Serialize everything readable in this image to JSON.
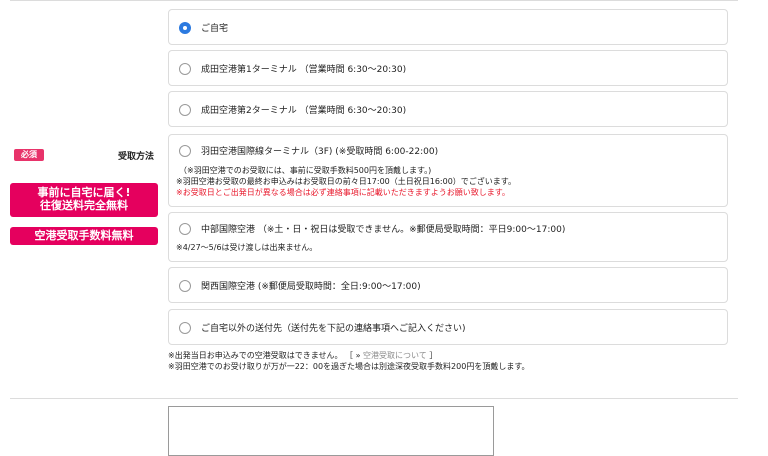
{
  "field": {
    "required_badge": "必須",
    "label": "受取方法"
  },
  "promo": {
    "line1": "事前に自宅に届く!",
    "line2": "往復送料完全無料",
    "line3": "空港受取手数料無料"
  },
  "options": [
    {
      "label": "ご自宅",
      "checked": true
    },
    {
      "label": "成田空港第1ターミナル （営業時間 6:30〜20:30)",
      "checked": false
    },
    {
      "label": "成田空港第2ターミナル （営業時間 6:30〜20:30)",
      "checked": false
    },
    {
      "label": "羽田空港国際線ターミナル（3F) (※受取時間 6:00-22:00)",
      "checked": false,
      "notes": [
        "（※羽田空港でのお受取には、事前に受取手数料500円を頂戴します。)",
        "※羽田空港お受取の最終お申込みはお受取日の前々日17:00（土日祝日16:00）でございます。",
        "※お受取日とご出発日が異なる場合は必ず連絡事項に記載いただきますようお願い致します。"
      ]
    },
    {
      "label": "中部国際空港 （※土・日・祝日は受取できません。※郵便局受取時間：平日9:00〜17:00)",
      "checked": false,
      "notes": [
        "※4/27〜5/6は受け渡しは出来ません。"
      ]
    },
    {
      "label": "関西国際空港 (※郵便局受取時間：全日:9:00〜17:00)",
      "checked": false
    },
    {
      "label": "ご自宅以外の送付先（送付先を下記の連絡事項へご記入ください)",
      "checked": false
    }
  ],
  "footnotes": {
    "line1_text": "※出発当日お申込みでの空港受取はできません。 ［",
    "line1_arrow": "»",
    "line1_link": "空港受取について",
    "line1_end": "］",
    "line2": "※羽田空港でのお受け取りが万が一22：00を過ぎた場合は別途深夜受取手数料200円を頂戴します。"
  },
  "colors": {
    "accent": "#2c7ae0",
    "promo_bg": "#e5005e",
    "badge_bg": "#e8336a",
    "warning_text": "#e8192c"
  }
}
